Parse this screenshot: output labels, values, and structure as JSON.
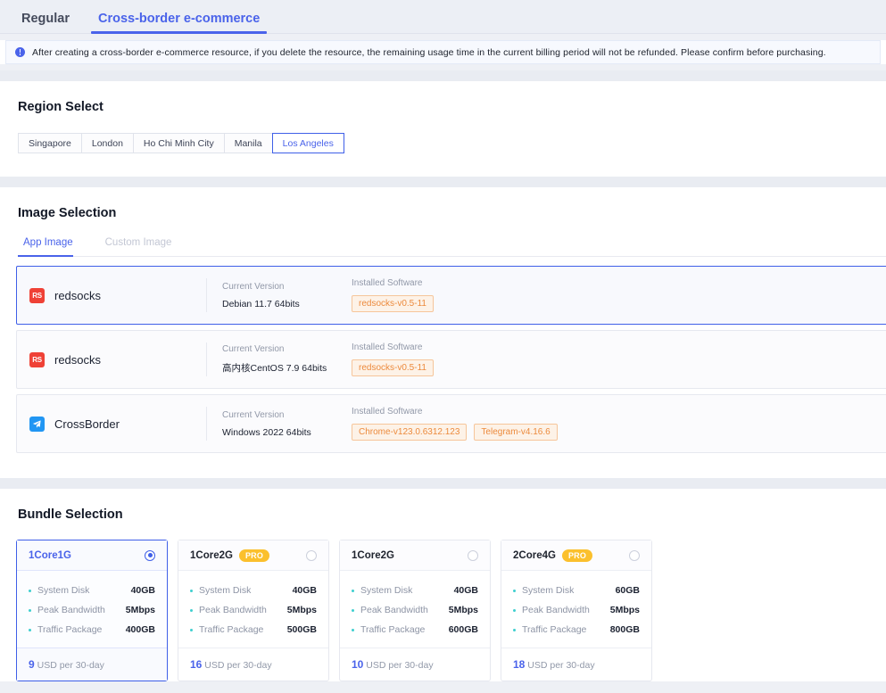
{
  "tabs": [
    {
      "label": "Regular",
      "active": false
    },
    {
      "label": "Cross-border e-commerce",
      "active": true
    }
  ],
  "notice": {
    "icon": "info-icon",
    "text": "After creating a cross-border e-commerce resource, if you delete the resource, the remaining usage time in the current billing period will not be refunded. Please confirm before purchasing."
  },
  "region_section": {
    "title": "Region Select",
    "options": [
      {
        "label": "Singapore",
        "selected": false
      },
      {
        "label": "London",
        "selected": false
      },
      {
        "label": "Ho Chi Minh City",
        "selected": false
      },
      {
        "label": "Manila",
        "selected": false
      },
      {
        "label": "Los Angeles",
        "selected": true
      }
    ]
  },
  "image_section": {
    "title": "Image Selection",
    "tabs": [
      {
        "label": "App Image",
        "active": true
      },
      {
        "label": "Custom Image",
        "active": false
      }
    ],
    "labels": {
      "current_version": "Current Version",
      "installed_software": "Installed Software"
    },
    "images": [
      {
        "name": "redsocks",
        "icon": "redsocks-icon",
        "icon_text": "RS",
        "version": "Debian 11.7 64bits",
        "software": [
          "redsocks-v0.5-11"
        ],
        "selected": true
      },
      {
        "name": "redsocks",
        "icon": "redsocks-icon",
        "icon_text": "RS",
        "version": "高内核CentOS 7.9 64bits",
        "software": [
          "redsocks-v0.5-11"
        ],
        "selected": false
      },
      {
        "name": "CrossBorder",
        "icon": "crossborder-icon",
        "icon_text": "",
        "version": "Windows 2022 64bits",
        "software": [
          "Chrome-v123.0.6312.123",
          "Telegram-v4.16.6"
        ],
        "selected": false
      }
    ]
  },
  "bundle_section": {
    "title": "Bundle Selection",
    "bundles": [
      {
        "name": "1Core1G",
        "pro": false,
        "selected": true,
        "specs": [
          {
            "label": "System Disk",
            "value": "40GB"
          },
          {
            "label": "Peak Bandwidth",
            "value": "5Mbps"
          },
          {
            "label": "Traffic Package",
            "value": "400GB"
          }
        ],
        "price": "9",
        "price_unit": "USD per 30-day"
      },
      {
        "name": "1Core2G",
        "pro": true,
        "pro_label": "PRO",
        "selected": false,
        "specs": [
          {
            "label": "System Disk",
            "value": "40GB"
          },
          {
            "label": "Peak Bandwidth",
            "value": "5Mbps"
          },
          {
            "label": "Traffic Package",
            "value": "500GB"
          }
        ],
        "price": "16",
        "price_unit": "USD per 30-day"
      },
      {
        "name": "1Core2G",
        "pro": false,
        "selected": false,
        "specs": [
          {
            "label": "System Disk",
            "value": "40GB"
          },
          {
            "label": "Peak Bandwidth",
            "value": "5Mbps"
          },
          {
            "label": "Traffic Package",
            "value": "600GB"
          }
        ],
        "price": "10",
        "price_unit": "USD per 30-day"
      },
      {
        "name": "2Core4G",
        "pro": true,
        "pro_label": "PRO",
        "selected": false,
        "specs": [
          {
            "label": "System Disk",
            "value": "60GB"
          },
          {
            "label": "Peak Bandwidth",
            "value": "5Mbps"
          },
          {
            "label": "Traffic Package",
            "value": "800GB"
          }
        ],
        "price": "18",
        "price_unit": "USD per 30-day"
      }
    ]
  },
  "colors": {
    "accent": "#4a63ea",
    "chip_border": "#f6c59a",
    "chip_text": "#ec8a3c",
    "pro_badge": "#fbc02d",
    "dot": "#3ecfcf",
    "redsocks_icon": "#ef4136",
    "crossborder_icon": "#2196f3"
  }
}
